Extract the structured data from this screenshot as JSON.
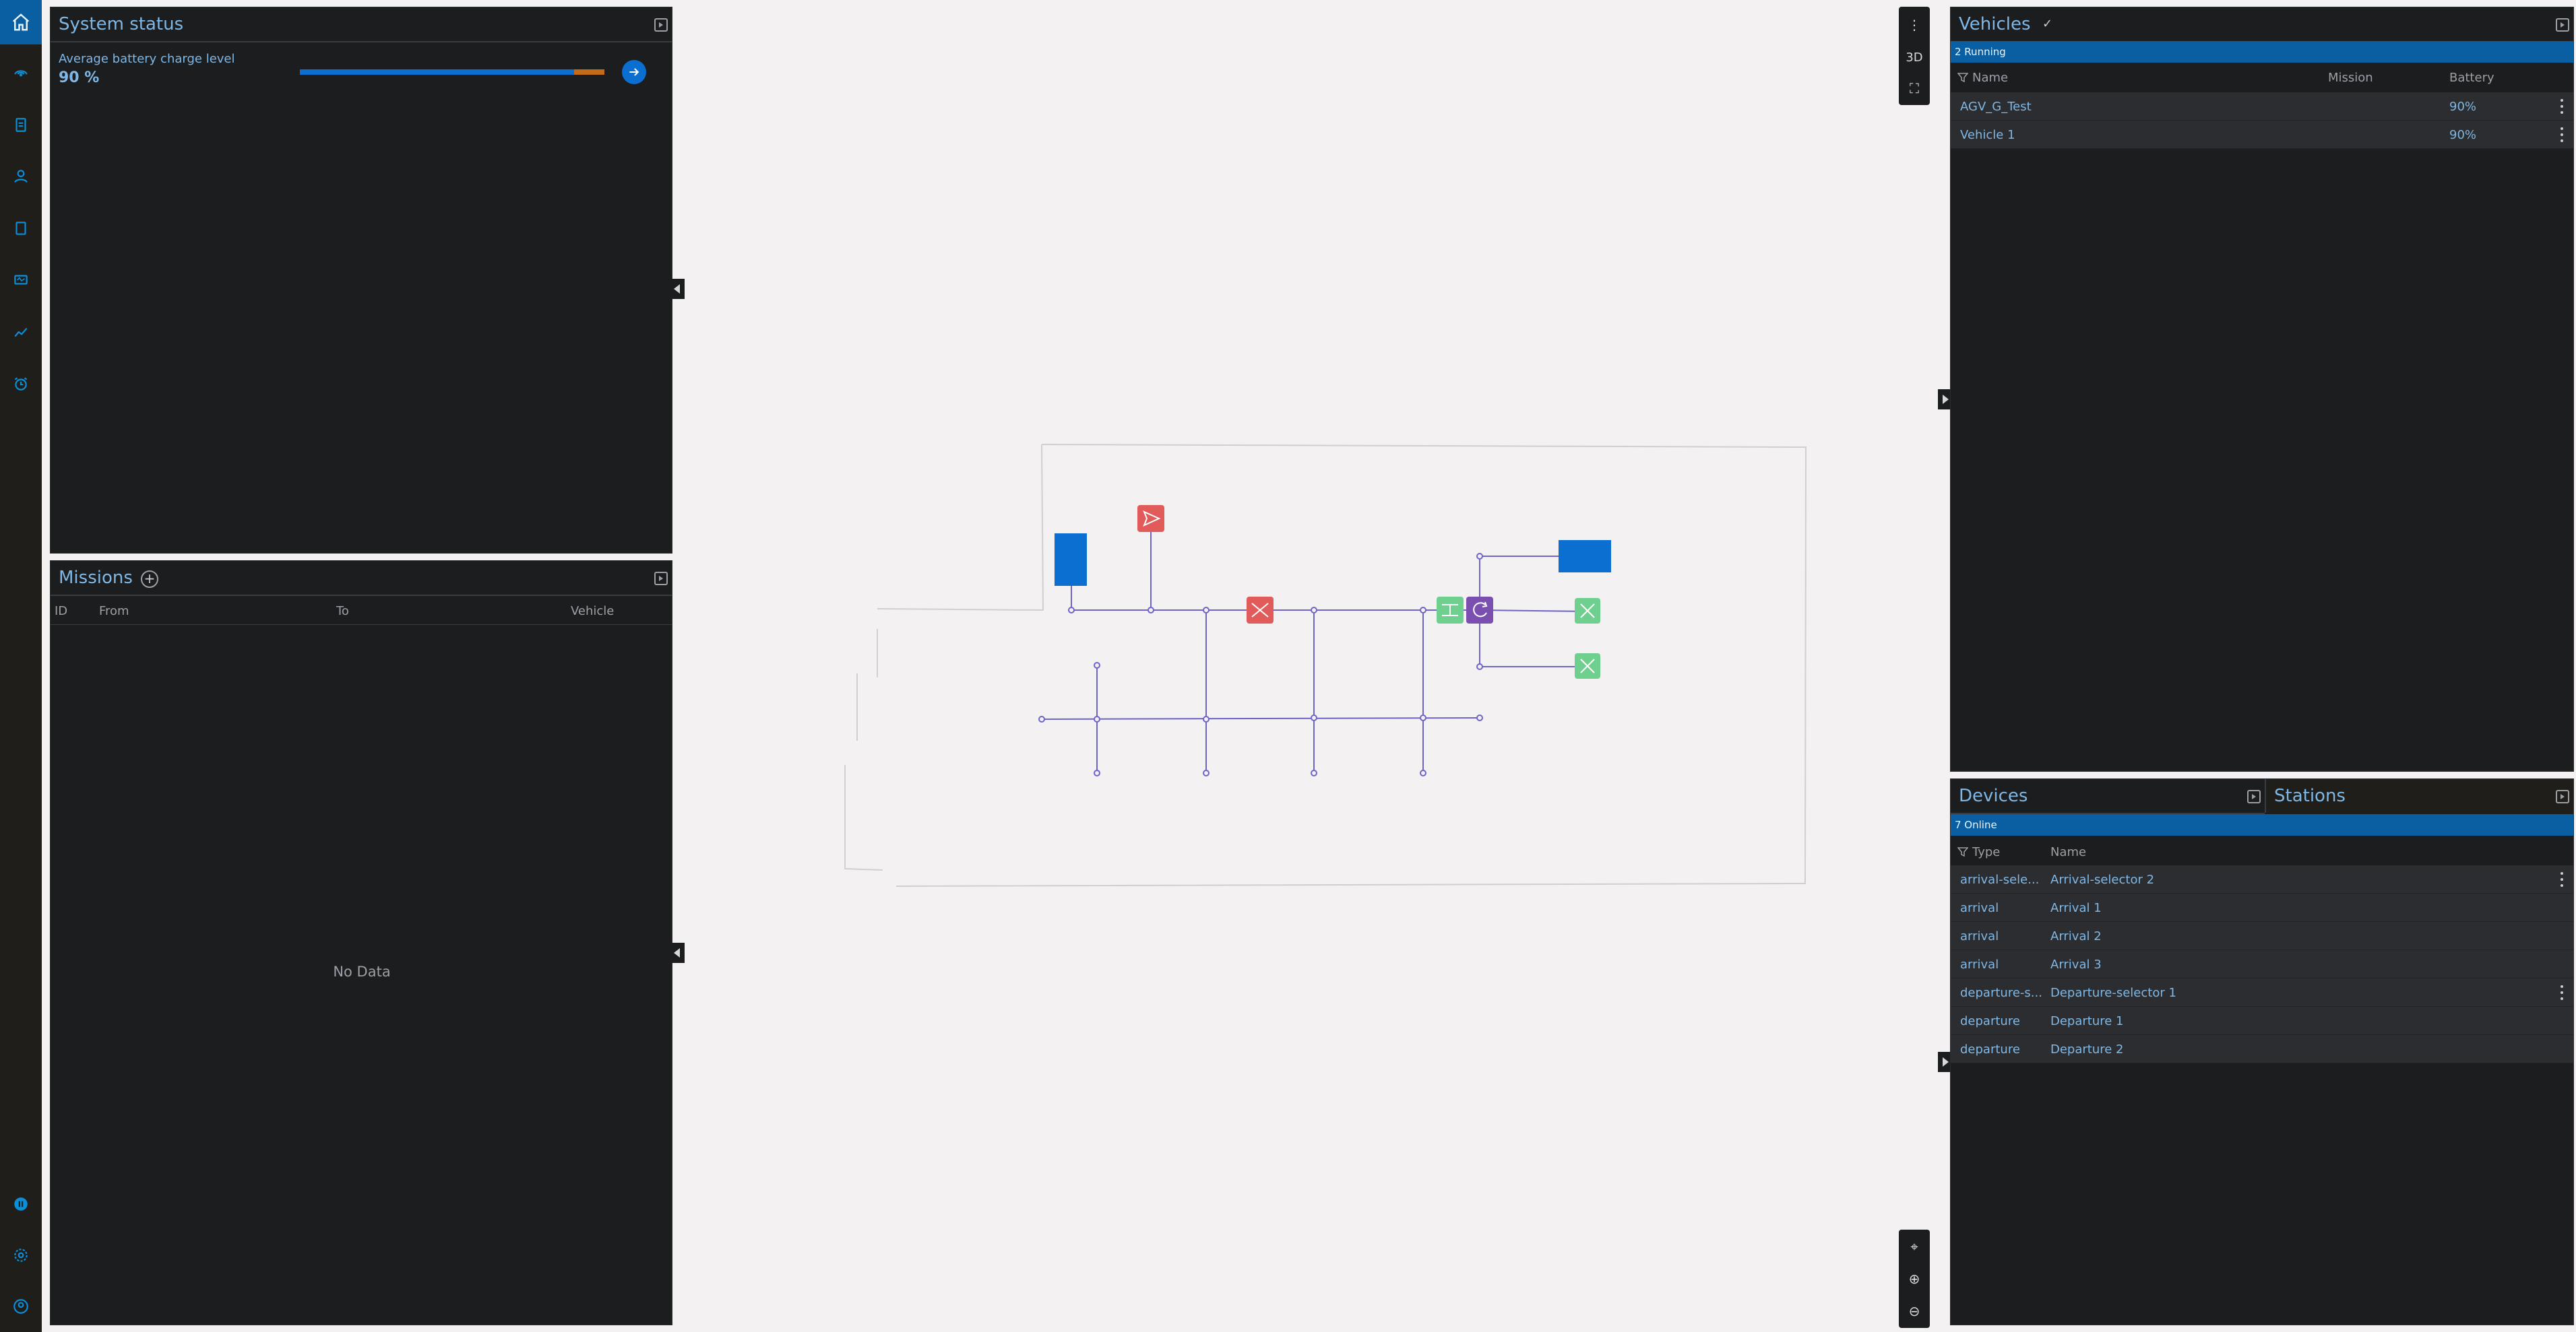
{
  "rail": {
    "icons": [
      "home-icon",
      "radar-icon",
      "clipboard-icon",
      "fleet-icon",
      "book-icon",
      "monitor-icon",
      "chart-icon",
      "alarm-icon",
      "pause-icon",
      "settings-icon",
      "user-icon"
    ]
  },
  "system_status": {
    "title": "System status",
    "battery_label": "Average battery charge level",
    "battery_value": "90 %",
    "battery_fraction": 0.9
  },
  "missions": {
    "title": "Missions",
    "columns": [
      "ID",
      "From",
      "To",
      "Vehicle"
    ],
    "empty_text": "No Data"
  },
  "map": {
    "toolbar_top": [
      "⋮",
      "3D",
      "⛶"
    ],
    "toolbar_bottom": [
      "⌖",
      "⊕",
      "⊖"
    ]
  },
  "vehicles": {
    "title": "Vehicles",
    "edit_glyph": "✓",
    "status_text": "2 Running",
    "columns": [
      "Name",
      "Mission",
      "Battery"
    ],
    "rows": [
      {
        "name": "AGV_G_Test",
        "mission": "",
        "battery": "90%"
      },
      {
        "name": "Vehicle 1",
        "mission": "",
        "battery": "90%"
      }
    ]
  },
  "devices": {
    "tab_devices": "Devices",
    "tab_stations": "Stations",
    "status_text": "7 Online",
    "columns": [
      "Type",
      "Name"
    ],
    "rows": [
      {
        "type": "arrival-sele...",
        "name": "Arrival-selector 2",
        "menu": true
      },
      {
        "type": "arrival",
        "name": "Arrival 1",
        "menu": false
      },
      {
        "type": "arrival",
        "name": "Arrival 2",
        "menu": false
      },
      {
        "type": "arrival",
        "name": "Arrival 3",
        "menu": false
      },
      {
        "type": "departure-s...",
        "name": "Departure-selector 1",
        "menu": true
      },
      {
        "type": "departure",
        "name": "Departure 1",
        "menu": false
      },
      {
        "type": "departure",
        "name": "Departure 2",
        "menu": false
      }
    ]
  },
  "colors": {
    "accent": "#0a5fa3",
    "link": "#7fb8e6",
    "panel": "#1c1d1f",
    "path": "#6d63c9",
    "arrival": "#6fcf8e",
    "departure": "#e15b5b",
    "selector": "#7b4fb0",
    "station": "#0a6fd0"
  }
}
